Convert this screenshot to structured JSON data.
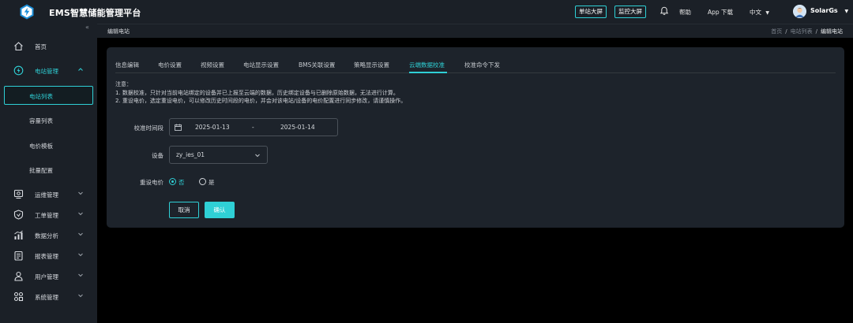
{
  "app": {
    "title": "EMS智慧储能管理平台",
    "accent_color": "#2fd0d6"
  },
  "topbar": {
    "single_screen_btn": "单站大屏",
    "monitor_screen_btn": "监控大屏",
    "bell_icon": "bell-icon",
    "help_label": "帮助",
    "app_download_label": "App 下载",
    "language_label": "中文",
    "user_name": "SolarGs"
  },
  "sidebar": {
    "collapse_glyph": "«",
    "items": [
      {
        "label": "首页",
        "icon": "home-icon"
      },
      {
        "label": "电站管理",
        "icon": "station-icon"
      },
      {
        "label": "运维管理",
        "icon": "maintenance-icon"
      },
      {
        "label": "工单管理",
        "icon": "workorder-icon"
      },
      {
        "label": "数据分析",
        "icon": "analytics-icon"
      },
      {
        "label": "报表管理",
        "icon": "report-icon"
      },
      {
        "label": "用户管理",
        "icon": "user-icon"
      },
      {
        "label": "系统管理",
        "icon": "system-icon"
      }
    ],
    "sub_items": [
      "电站列表",
      "容量列表",
      "电价模板",
      "批量配置"
    ]
  },
  "crumbs": {
    "page_title": "编辑电站",
    "path": [
      "首页",
      "电站列表",
      "编辑电站"
    ]
  },
  "tabs": [
    "信息编辑",
    "电价设置",
    "视频设置",
    "电站显示设置",
    "BMS关联设置",
    "策略显示设置",
    "云端数据校准",
    "校准命令下发"
  ],
  "active_tab": "云端数据校准",
  "notes": [
    "注意：",
    "1. 数据校准，只针对当前电站绑定的设备并已上报至云端的数据，历史绑定设备与已删除原始数据，无法进行计算。",
    "2. 重设电价，选定重设电价，可以修改历史时间段的电价，并会对该电站/设备的电价配置进行同步修改，请谨慎操作。"
  ],
  "form": {
    "range_label": "校准时间段",
    "start_date": "2025-01-13",
    "range_sep": "-",
    "end_date": "2025-01-14",
    "device_label": "设备",
    "device_value": "zy_ies_01",
    "reset_price_label": "重设电价",
    "option_no": "否",
    "option_yes": "是",
    "selected_option": "否"
  },
  "buttons": {
    "cancel": "取消",
    "confirm": "确认"
  }
}
